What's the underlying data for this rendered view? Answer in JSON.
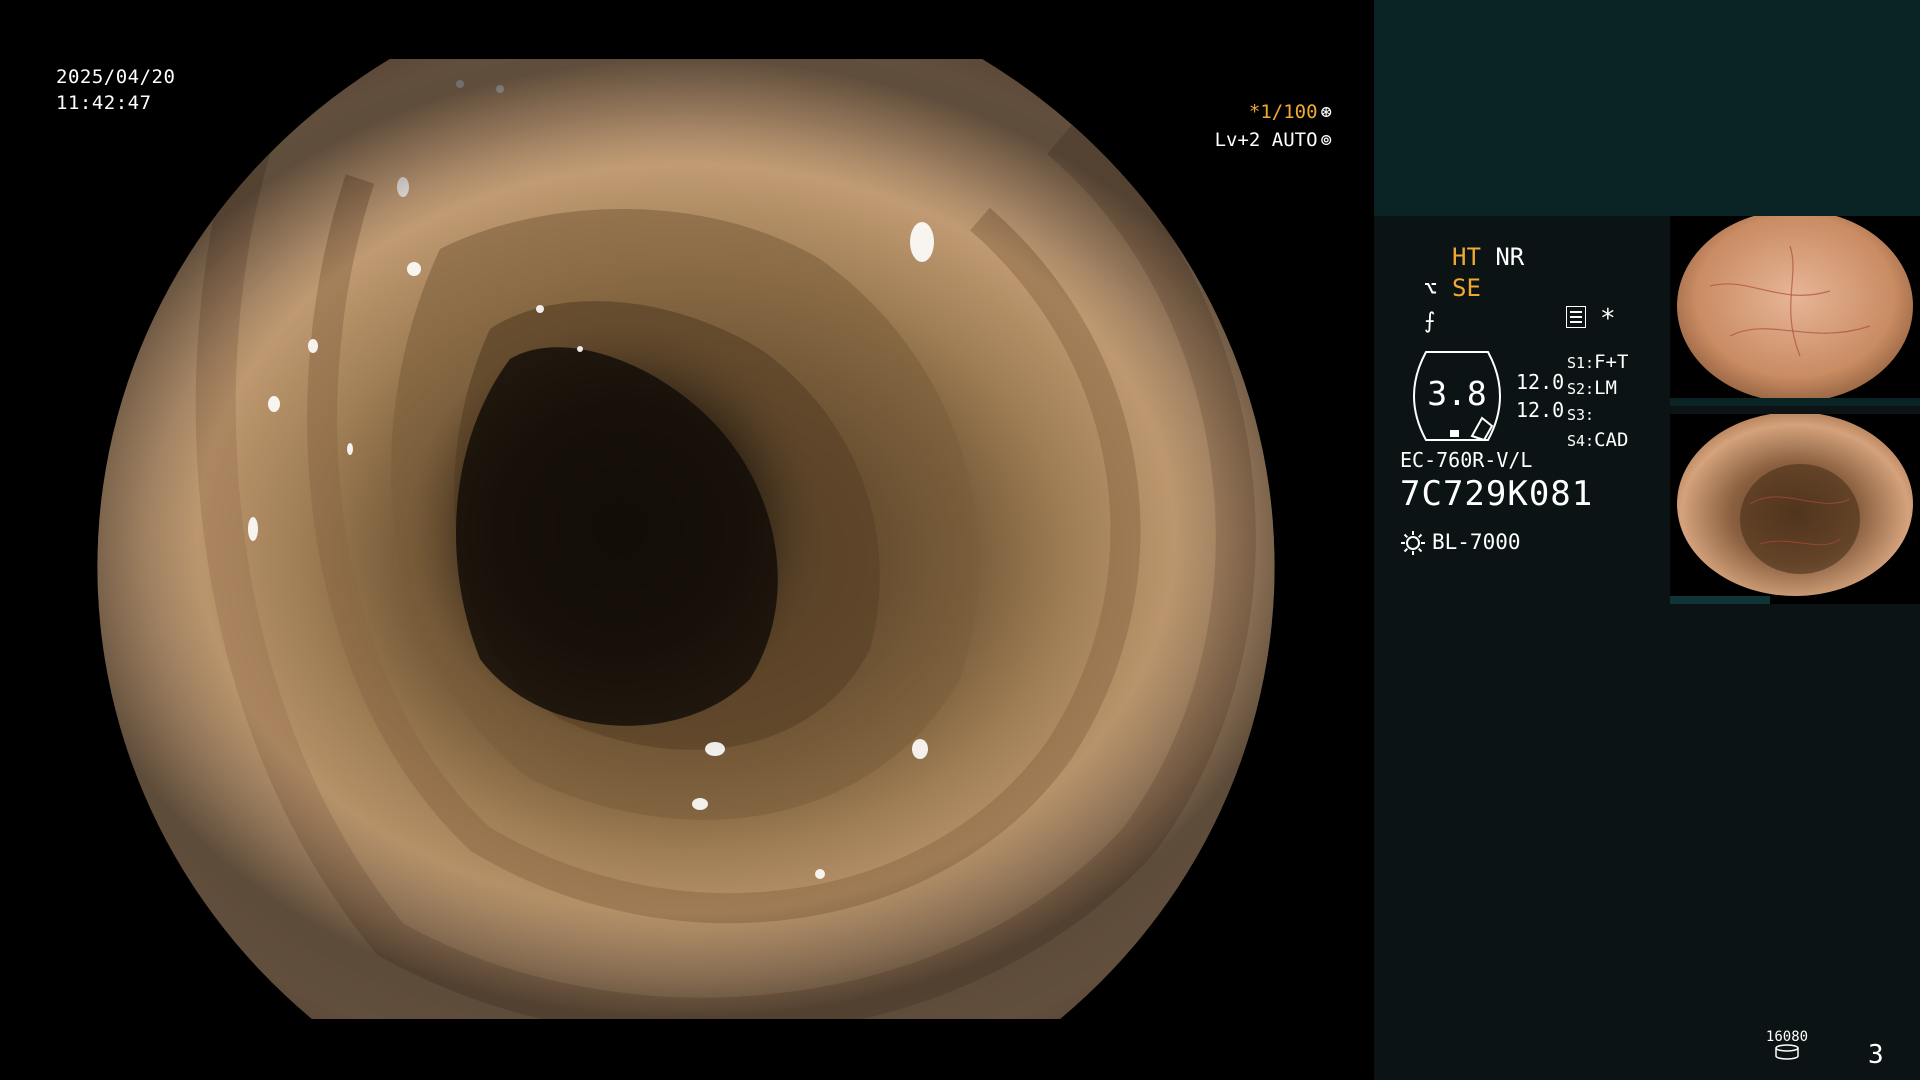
{
  "feed": {
    "date": "2025/04/20",
    "time": "11:42:47",
    "shutter": "*1/100",
    "iris": "Lv+2 AUTO"
  },
  "panel": {
    "enhancement": {
      "ht": "HT",
      "nr": "NR",
      "se": "SE"
    },
    "gauge_value": "3.8",
    "ratio_top": "12.0",
    "ratio_bottom": "12.0",
    "slots": [
      {
        "key": "S1:",
        "value": "F+T"
      },
      {
        "key": "S2:",
        "value": "LM"
      },
      {
        "key": "S3:",
        "value": ""
      },
      {
        "key": "S4:",
        "value": "CAD"
      }
    ],
    "scope_model": "EC-760R-V/L",
    "serial": "7C729K081",
    "light_source": "BL-7000",
    "storage_count": "16080",
    "page_number": "3"
  },
  "colors": {
    "accent_orange": "#f2a933",
    "panel_bg": "#0c1314",
    "panel_top": "#0a2426"
  }
}
